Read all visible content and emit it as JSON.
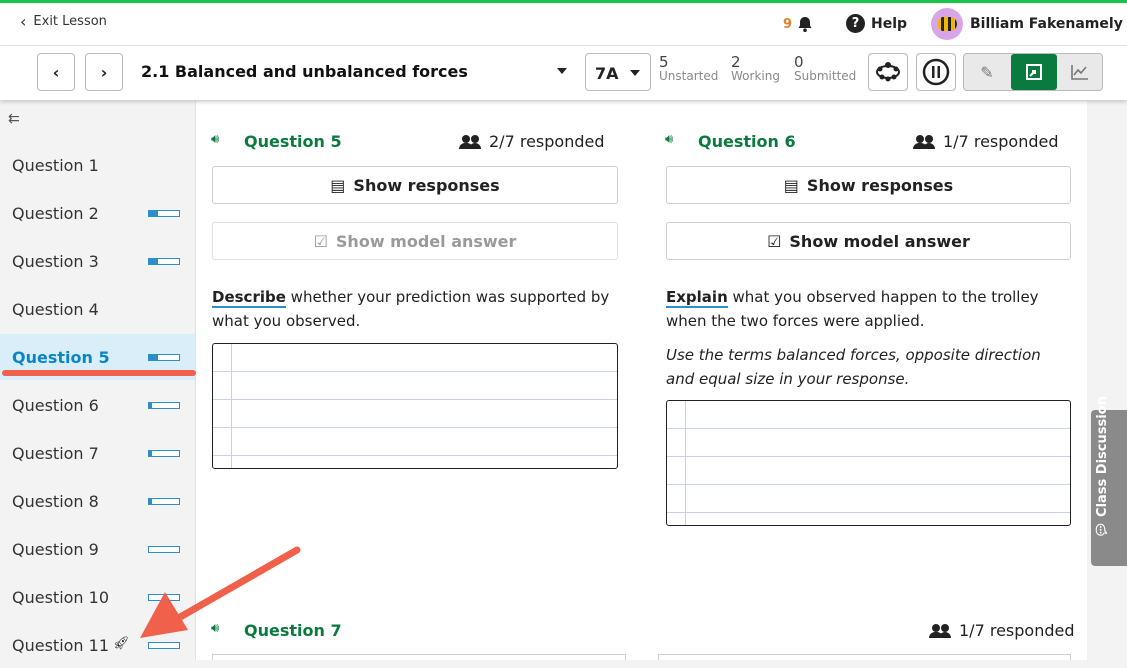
{
  "header": {
    "exit_label": "Exit Lesson",
    "notification_count": "9",
    "help_label": "Help",
    "user_name": "Billiam Fakenamely"
  },
  "toolbar": {
    "lesson_title": "2.1 Balanced and unbalanced forces",
    "class_name": "7A",
    "stats": [
      {
        "value": "5",
        "label": "Unstarted"
      },
      {
        "value": "2",
        "label": "Working"
      },
      {
        "value": "0",
        "label": "Submitted"
      }
    ]
  },
  "sidebar": {
    "items": [
      {
        "label": "Question 1",
        "progress": null
      },
      {
        "label": "Question 2",
        "progress": 0.3
      },
      {
        "label": "Question 3",
        "progress": 0.3
      },
      {
        "label": "Question 4",
        "progress": null
      },
      {
        "label": "Question 5",
        "progress": 0.3,
        "active": true
      },
      {
        "label": "Question 6",
        "progress": 0.1
      },
      {
        "label": "Question 7",
        "progress": 0.1
      },
      {
        "label": "Question 8",
        "progress": 0.1
      },
      {
        "label": "Question 9",
        "progress": 0.0
      },
      {
        "label": "Question 10",
        "progress": 0.0
      },
      {
        "label": "Question 11",
        "progress": 0.0
      }
    ]
  },
  "questions": {
    "q5": {
      "title": "Question 5",
      "responded": "2/7 responded",
      "show_responses": "Show responses",
      "show_model": "Show model answer",
      "prompt_keyword": "Describe",
      "prompt_rest": " whether your prediction was supported by what you observed."
    },
    "q6": {
      "title": "Question 6",
      "responded": "1/7 responded",
      "show_responses": "Show responses",
      "show_model": "Show model answer",
      "prompt_keyword": "Explain",
      "prompt_rest": " what you observed happen to the trolley when the two forces were applied.",
      "hint": "Use the terms balanced forces, opposite direction and equal size in your response."
    },
    "q7": {
      "title": "Question 7",
      "responded": "1/7 responded"
    }
  },
  "class_discussion_label": "Class Discussion",
  "colors": {
    "accent_green": "#0b7a3e",
    "progress_blue": "#2b8ec8",
    "annotation_red": "#f0604a"
  }
}
